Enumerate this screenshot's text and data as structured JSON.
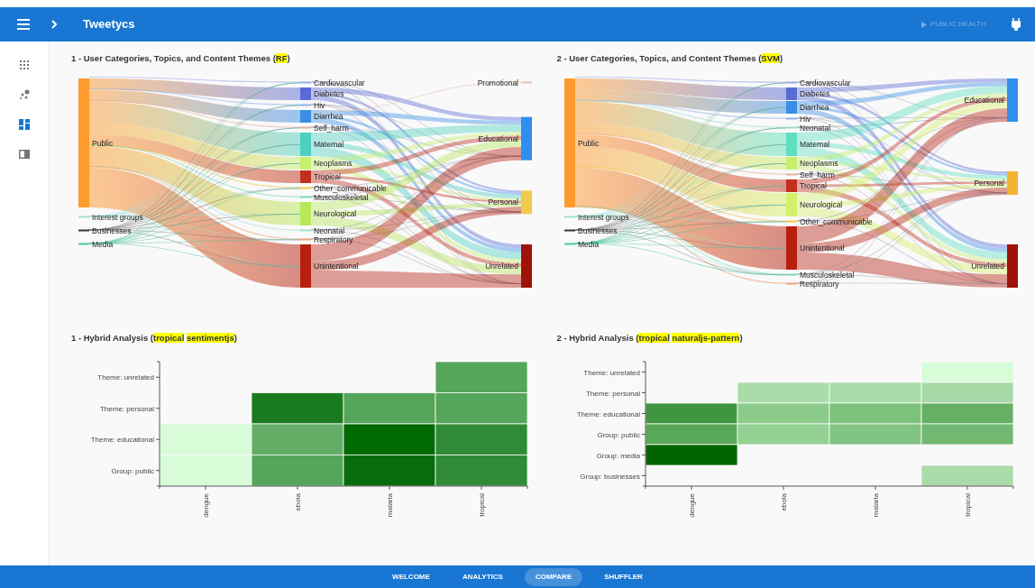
{
  "header": {
    "title": "Tweetycs",
    "context": {
      "label": "PUBLIC HEALTH",
      "disabled": true
    }
  },
  "sidebar": {
    "items": [
      {
        "kind": "apps",
        "selected": false
      },
      {
        "kind": "scatter",
        "selected": false
      },
      {
        "kind": "dashboard",
        "selected": true
      },
      {
        "kind": "panel",
        "selected": false
      }
    ]
  },
  "sankeys": [
    {
      "title": {
        "prefix": "1 - User Categories, Topics, and Content Themes (",
        "highlights": [
          "RF"
        ],
        "suffix": ")"
      },
      "sources": [
        {
          "label": "Public",
          "kind": "xl",
          "color": "#ff9a2e"
        },
        {
          "label": "Interest groups",
          "kind": "tiny",
          "color": "#9fe3d8"
        },
        {
          "label": "Businesses",
          "kind": "tiny",
          "color": "#333333"
        },
        {
          "label": "Media",
          "kind": "tiny",
          "color": "#4ac4a0"
        }
      ],
      "topics": [
        {
          "label": "Cardiovascular",
          "kind": "tiny",
          "color": "#9aa8e8"
        },
        {
          "label": "Diabetes",
          "kind": "small",
          "color": "#5a6bd6"
        },
        {
          "label": "Hiv",
          "kind": "tiny",
          "color": "#8fb0e8"
        },
        {
          "label": "Diarrhea",
          "kind": "small",
          "color": "#3a8ee6"
        },
        {
          "label": "Self_harm",
          "kind": "tiny",
          "color": "#e8b0a0"
        },
        {
          "label": "Maternal",
          "kind": "medium",
          "color": "#4dd0c0"
        },
        {
          "label": "Neoplasms",
          "kind": "small",
          "color": "#c6ef6e"
        },
        {
          "label": "Tropical",
          "kind": "small",
          "color": "#c0301c"
        },
        {
          "label": "Other_communicable",
          "kind": "tiny",
          "color": "#f5c842"
        },
        {
          "label": "Musculoskeletal",
          "kind": "tiny",
          "color": "#7ad9b0"
        },
        {
          "label": "Neurological",
          "kind": "medium",
          "color": "#b7e85a"
        },
        {
          "label": "Neonatal",
          "kind": "tiny",
          "color": "#9de0d0"
        },
        {
          "label": "Respiratory",
          "kind": "tiny",
          "color": "#f0a070"
        },
        {
          "label": "Unintentional",
          "kind": "large",
          "color": "#b5200f"
        }
      ],
      "themes": [
        {
          "label": "Promotional",
          "kind": "tiny",
          "color": "#e8c0a8"
        },
        {
          "label": "Educational",
          "kind": "large",
          "color": "#2f8fee"
        },
        {
          "label": "Personal",
          "kind": "medium",
          "color": "#f2c94c"
        },
        {
          "label": "Unrelated",
          "kind": "large",
          "color": "#9e1309"
        }
      ]
    },
    {
      "title": {
        "prefix": "2 - User Categories, Topics, and Content Themes (",
        "highlights": [
          "SVM"
        ],
        "suffix": ")"
      },
      "sources": [
        {
          "label": "Public",
          "kind": "xl",
          "color": "#ff9a2e"
        },
        {
          "label": "Interest groups",
          "kind": "tiny",
          "color": "#9fe3d8"
        },
        {
          "label": "Businesses",
          "kind": "tiny",
          "color": "#333333"
        },
        {
          "label": "Media",
          "kind": "tiny",
          "color": "#4ac4a0"
        }
      ],
      "topics": [
        {
          "label": "Cardiovascular",
          "kind": "tiny",
          "color": "#9aa8e8"
        },
        {
          "label": "Diabetes",
          "kind": "small",
          "color": "#5a6bd6"
        },
        {
          "label": "Diarrhea",
          "kind": "small",
          "color": "#3a8ee6"
        },
        {
          "label": "Hiv",
          "kind": "tiny",
          "color": "#8fb0e8"
        },
        {
          "label": "Neonatal",
          "kind": "tiny",
          "color": "#9de0d0"
        },
        {
          "label": "Maternal",
          "kind": "medium",
          "color": "#5ee0c0"
        },
        {
          "label": "Neoplasms",
          "kind": "small",
          "color": "#c6ef6e"
        },
        {
          "label": "Self_harm",
          "kind": "tiny",
          "color": "#e8b0a0"
        },
        {
          "label": "Tropical",
          "kind": "small",
          "color": "#c0301c"
        },
        {
          "label": "Neurological",
          "kind": "medium",
          "color": "#d4f06a"
        },
        {
          "label": "Other_communicable",
          "kind": "tiny",
          "color": "#f5c842"
        },
        {
          "label": "Unintentional",
          "kind": "large",
          "color": "#b5200f"
        },
        {
          "label": "Musculoskeletal",
          "kind": "tiny",
          "color": "#7ad9b0"
        },
        {
          "label": "Respiratory",
          "kind": "tiny",
          "color": "#f0a070"
        }
      ],
      "themes": [
        {
          "label": "Educational",
          "kind": "large",
          "color": "#2f8fee"
        },
        {
          "label": "Personal",
          "kind": "medium",
          "color": "#f5b430"
        },
        {
          "label": "Unrelated",
          "kind": "large",
          "color": "#9e1309"
        }
      ]
    }
  ],
  "heatmaps": [
    {
      "title": {
        "prefix": "1 - Hybrid Analysis (",
        "highlights": [
          "tropical",
          "sentimentjs"
        ],
        "suffix": ")"
      },
      "columns": [
        "dengue",
        "ebola",
        "malaria",
        "tropical"
      ],
      "rows": [
        {
          "label": "Theme: unrelated",
          "cells": [
            null,
            null,
            null,
            {
              "color": "#55a65a"
            }
          ]
        },
        {
          "label": "Theme: personal",
          "cells": [
            null,
            {
              "color": "#1a7a1e"
            },
            {
              "color": "#55a65a"
            },
            {
              "color": "#55a65a"
            }
          ]
        },
        {
          "label": "Theme: educational",
          "cells": [
            {
              "color": "#d8fcd8"
            },
            {
              "color": "#63ad66"
            },
            {
              "color": "#006900"
            },
            {
              "color": "#2f8b36"
            }
          ]
        },
        {
          "label": "Group: public",
          "cells": [
            {
              "color": "#d8fcd8"
            },
            {
              "color": "#55a65a"
            },
            {
              "color": "#066d0a"
            },
            {
              "color": "#2f8b36"
            }
          ]
        }
      ]
    },
    {
      "title": {
        "prefix": "2 - Hybrid Analysis (",
        "highlights": [
          "tropical",
          "naturaljs-pattern"
        ],
        "suffix": ")"
      },
      "columns": [
        "dengue",
        "ebola",
        "malaria",
        "tropical"
      ],
      "rows": [
        {
          "label": "Theme: unrelated",
          "cells": [
            null,
            null,
            null,
            {
              "color": "#d8fcd8"
            }
          ]
        },
        {
          "label": "Theme: personal",
          "cells": [
            null,
            {
              "color": "#a9dca9"
            },
            {
              "color": "#a9dca9"
            },
            {
              "color": "#a5d9a5"
            }
          ]
        },
        {
          "label": "Theme: educational",
          "cells": [
            {
              "color": "#409640"
            },
            {
              "color": "#8acb8a"
            },
            {
              "color": "#7dc17d"
            },
            {
              "color": "#66b066"
            }
          ]
        },
        {
          "label": "Group: public",
          "cells": [
            {
              "color": "#57a857"
            },
            {
              "color": "#94d294"
            },
            {
              "color": "#82c482"
            },
            {
              "color": "#72b872"
            }
          ]
        },
        {
          "label": "Group: media",
          "cells": [
            {
              "color": "#006400"
            },
            null,
            null,
            null
          ]
        },
        {
          "label": "Group: businesses",
          "cells": [
            null,
            null,
            null,
            {
              "color": "#a9dca9"
            }
          ]
        }
      ]
    }
  ],
  "footer": {
    "tabs": [
      {
        "label": "WELCOME",
        "selected": false
      },
      {
        "label": "ANALYTICS",
        "selected": false
      },
      {
        "label": "COMPARE",
        "selected": true
      },
      {
        "label": "SHUFFLER",
        "selected": false
      }
    ]
  }
}
